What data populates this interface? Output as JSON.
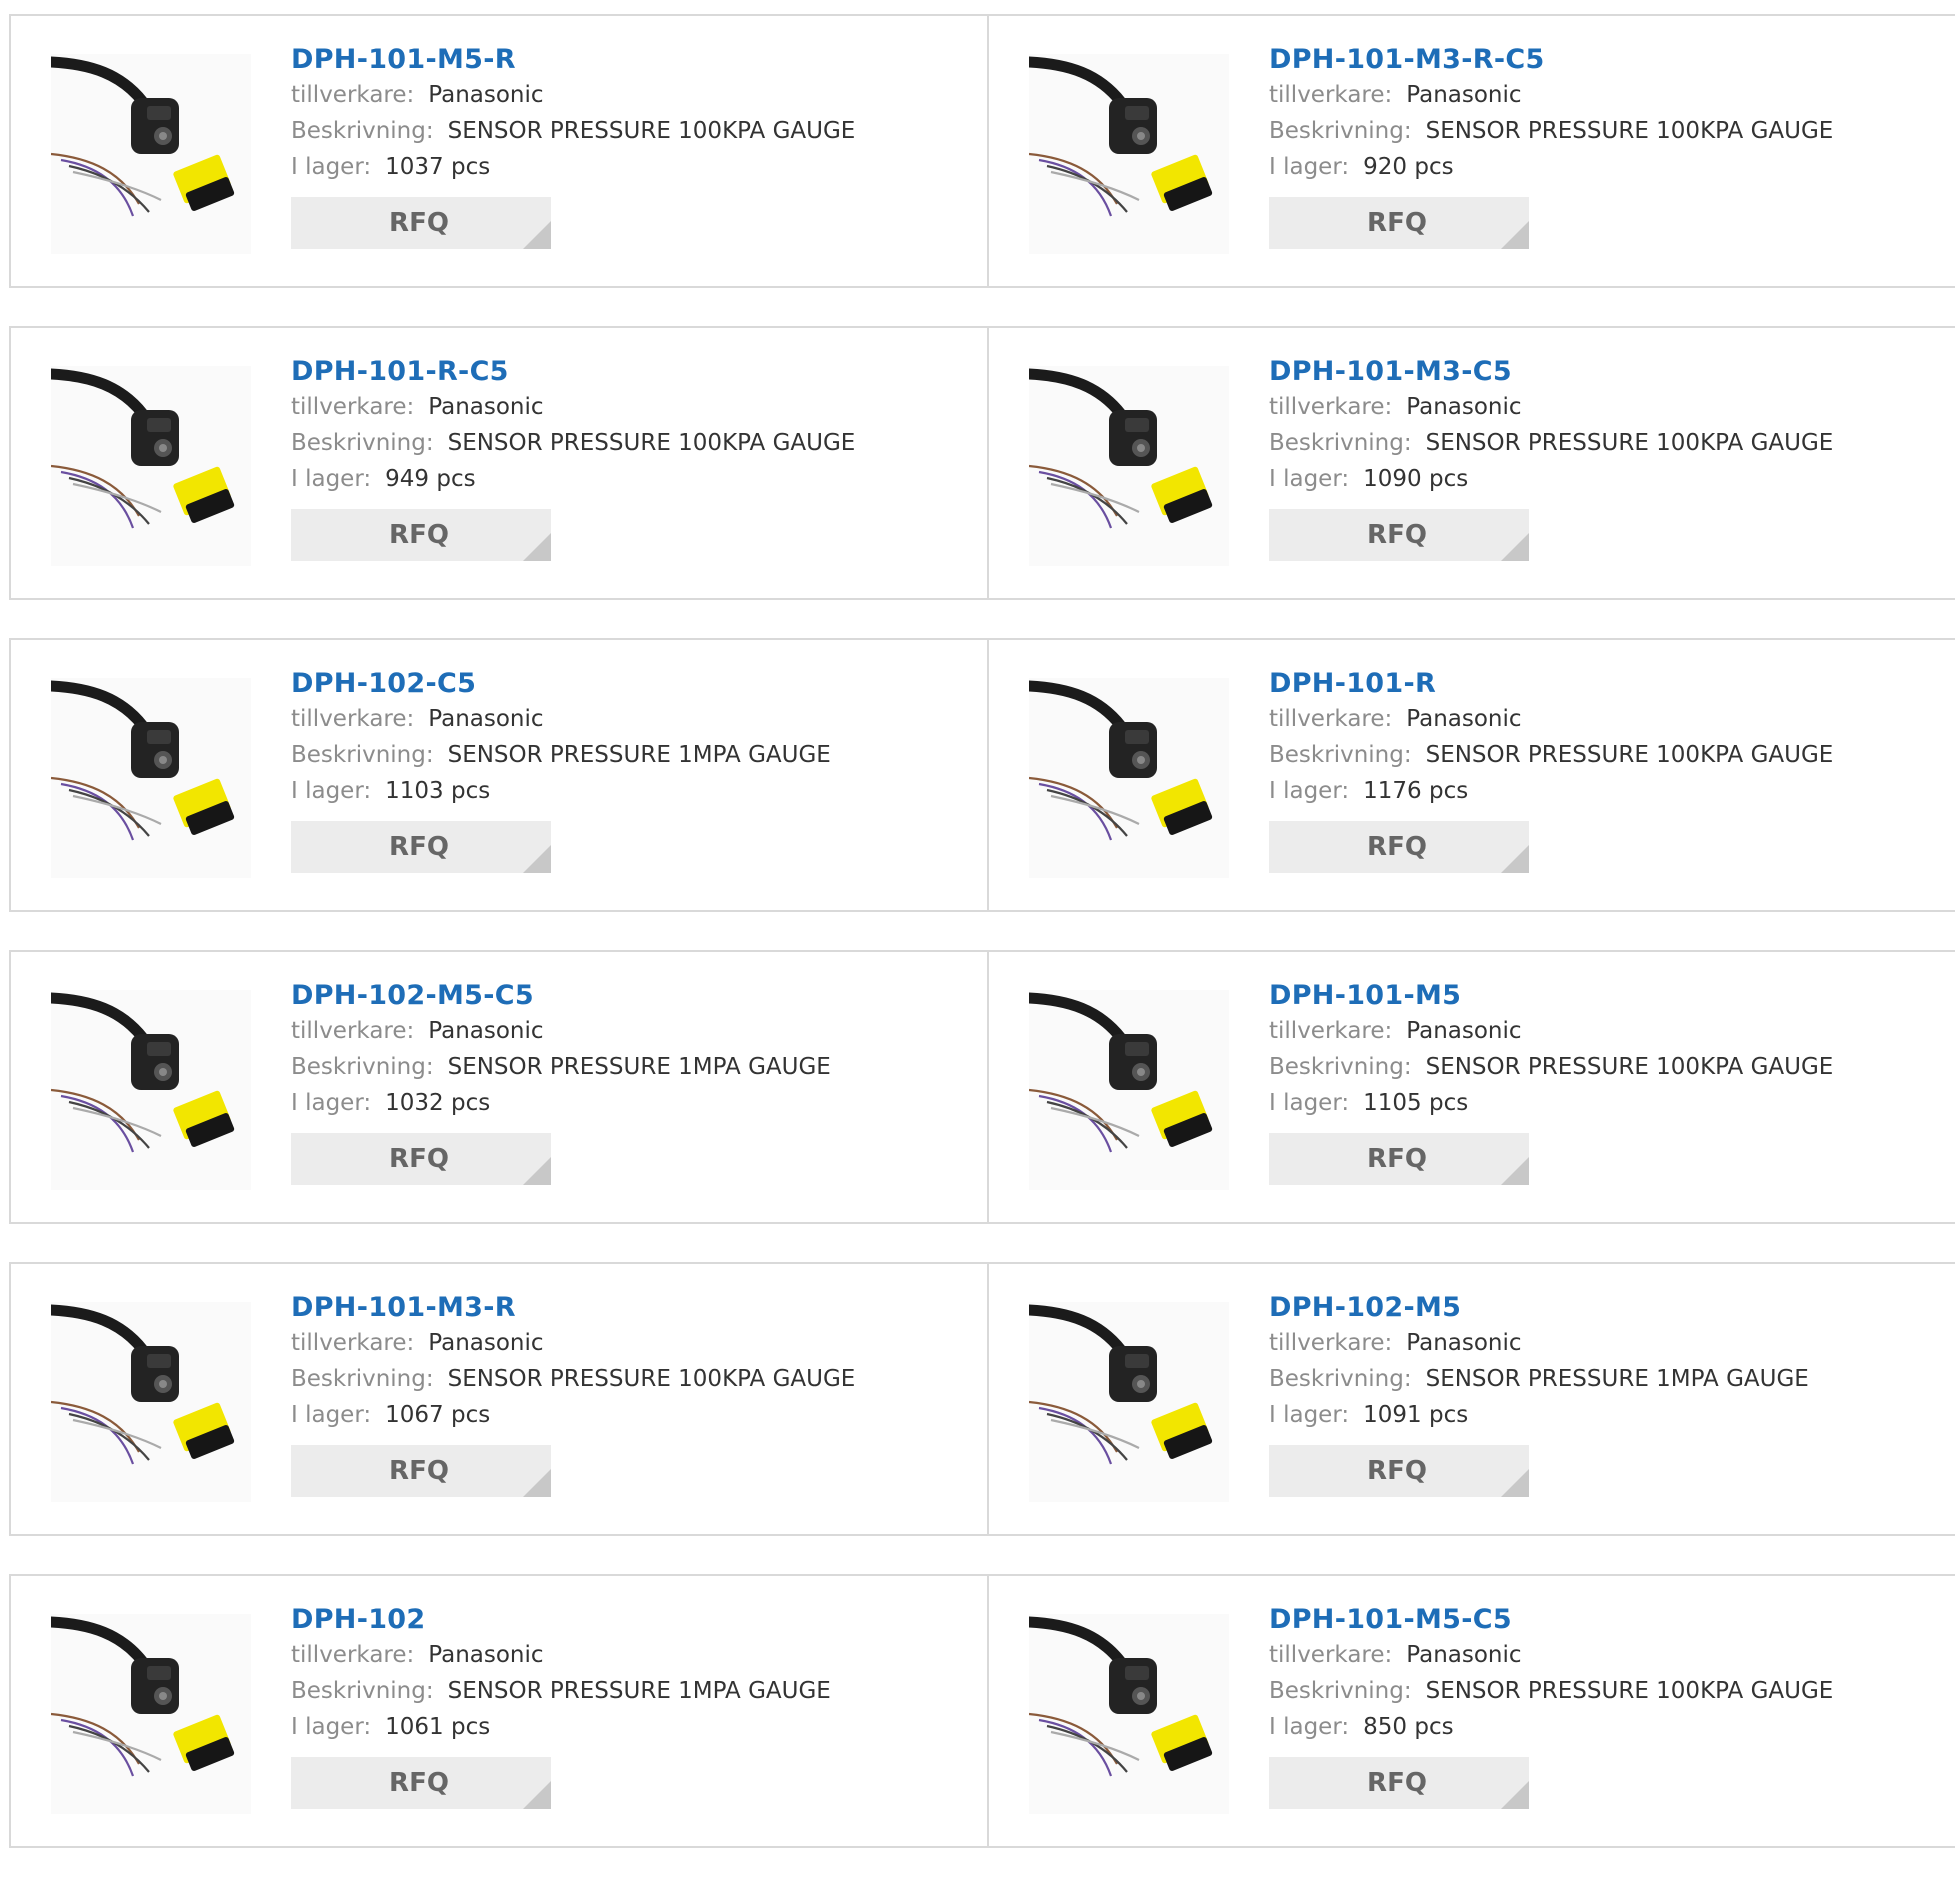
{
  "labels": {
    "manufacturer": "tillverkare:",
    "description": "Beskrivning:",
    "stock": "I lager:",
    "rfq": "RFQ"
  },
  "products": [
    {
      "part": "DPH-101-M5-R",
      "manufacturer": "Panasonic",
      "description": "SENSOR PRESSURE 100KPA GAUGE",
      "stock": "1037 pcs"
    },
    {
      "part": "DPH-101-M3-R-C5",
      "manufacturer": "Panasonic",
      "description": "SENSOR PRESSURE 100KPA GAUGE",
      "stock": "920 pcs"
    },
    {
      "part": "DPH-101-R-C5",
      "manufacturer": "Panasonic",
      "description": "SENSOR PRESSURE 100KPA GAUGE",
      "stock": "949 pcs"
    },
    {
      "part": "DPH-101-M3-C5",
      "manufacturer": "Panasonic",
      "description": "SENSOR PRESSURE 100KPA GAUGE",
      "stock": "1090 pcs"
    },
    {
      "part": "DPH-102-C5",
      "manufacturer": "Panasonic",
      "description": "SENSOR PRESSURE 1MPA GAUGE",
      "stock": "1103 pcs"
    },
    {
      "part": "DPH-101-R",
      "manufacturer": "Panasonic",
      "description": "SENSOR PRESSURE 100KPA GAUGE",
      "stock": "1176 pcs"
    },
    {
      "part": "DPH-102-M5-C5",
      "manufacturer": "Panasonic",
      "description": "SENSOR PRESSURE 1MPA GAUGE",
      "stock": "1032 pcs"
    },
    {
      "part": "DPH-101-M5",
      "manufacturer": "Panasonic",
      "description": "SENSOR PRESSURE 100KPA GAUGE",
      "stock": "1105 pcs"
    },
    {
      "part": "DPH-101-M3-R",
      "manufacturer": "Panasonic",
      "description": "SENSOR PRESSURE 100KPA GAUGE",
      "stock": "1067 pcs"
    },
    {
      "part": "DPH-102-M5",
      "manufacturer": "Panasonic",
      "description": "SENSOR PRESSURE 1MPA GAUGE",
      "stock": "1091 pcs"
    },
    {
      "part": "DPH-102",
      "manufacturer": "Panasonic",
      "description": "SENSOR PRESSURE 1MPA GAUGE",
      "stock": "1061 pcs"
    },
    {
      "part": "DPH-101-M5-C5",
      "manufacturer": "Panasonic",
      "description": "SENSOR PRESSURE 100KPA GAUGE",
      "stock": "850 pcs"
    }
  ],
  "colors": {
    "part_link": "#1e6db7",
    "label_gray": "#8c8c8c",
    "rfq_bg": "#ececec",
    "border": "#d9d9d9",
    "connector_yellow": "#f2e600"
  },
  "icons": {
    "thumbnail": "pressure-sensor-thumbnail"
  }
}
